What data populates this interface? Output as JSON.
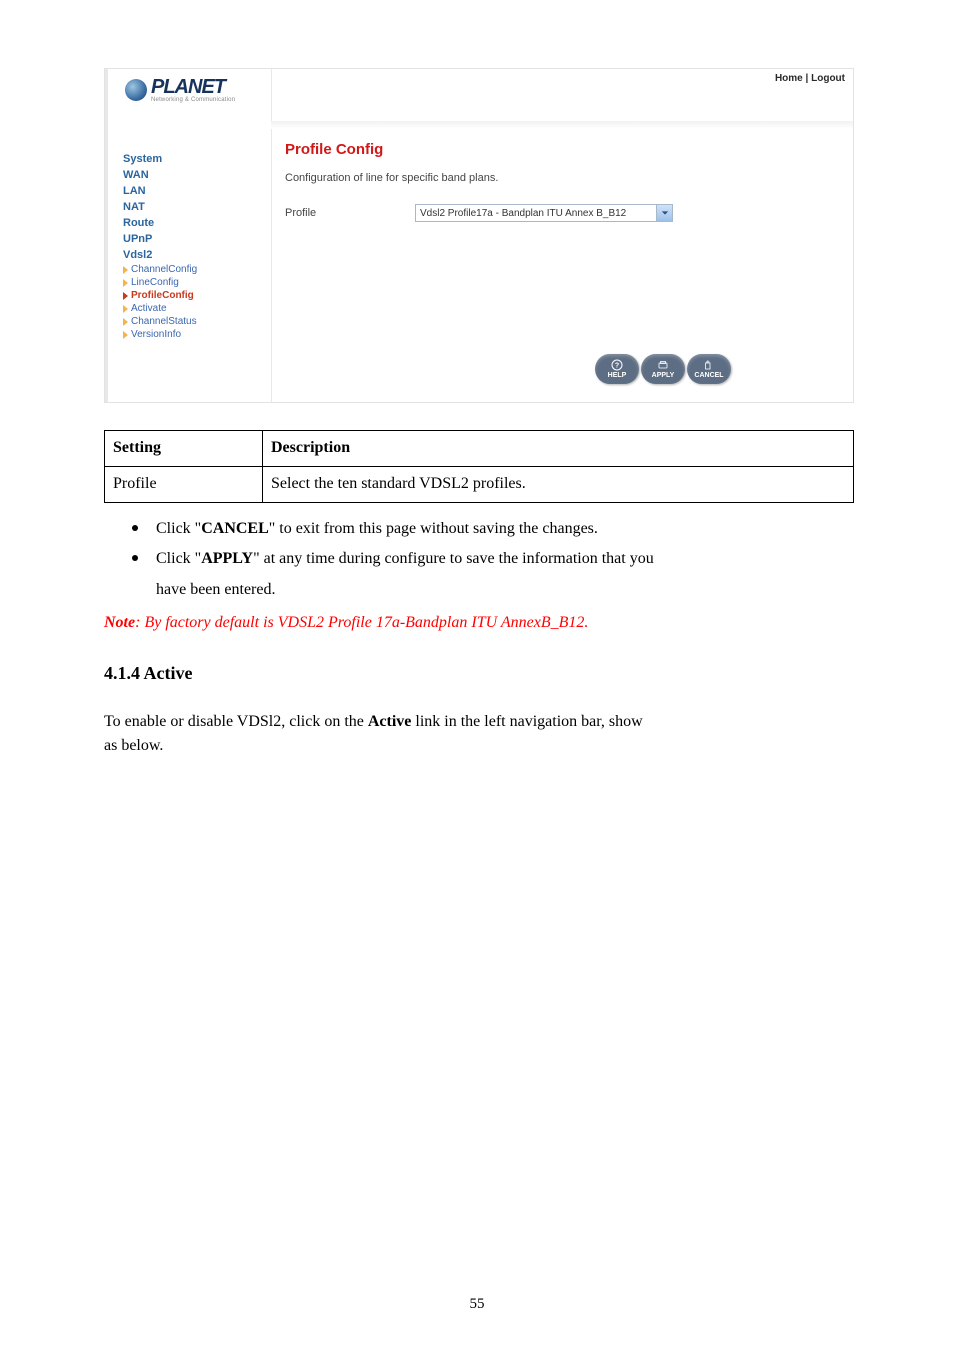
{
  "top_links": {
    "home": "Home",
    "sep": "|",
    "logout": "Logout"
  },
  "logo": {
    "brand": "PLANET",
    "tagline": "Networking & Communication"
  },
  "sidebar": {
    "items": [
      "System",
      "WAN",
      "LAN",
      "NAT",
      "Route",
      "UPnP",
      "Vdsl2"
    ],
    "subs": [
      "ChannelConfig",
      "LineConfig",
      "ProfileConfig",
      "Activate",
      "ChannelStatus",
      "VersionInfo"
    ],
    "active_sub_index": 2
  },
  "panel": {
    "title": "Profile Config",
    "subtitle": "Configuration of line for specific band plans.",
    "field_label": "Profile",
    "select_value": "Vdsl2 Profile17a - Bandplan ITU Annex B_B12"
  },
  "buttons": {
    "help": "HELP",
    "apply": "APPLY",
    "cancel": "CANCEL"
  },
  "table": {
    "head_setting": "Setting",
    "head_desc": "Description",
    "row_setting": "Profile",
    "row_desc": "Select the ten standard VDSL2 profiles."
  },
  "bullets": {
    "b1_pre": "Click \"",
    "b1_bold": "CANCEL",
    "b1_post": "\" to exit from this page without saving the changes.",
    "b2_pre": "Click \"",
    "b2_bold": "APPLY",
    "b2_post": "\" at any time during configure to save the information that you",
    "b2_cont": "have been entered."
  },
  "note": {
    "label": "Note",
    "text": ": By factory default is VDSL2 Profile 17a-Bandplan ITU AnnexB_B12."
  },
  "section": {
    "heading": "4.1.4  Active",
    "p1a": "To enable or disable VDSl2, click on the ",
    "p1b": "Active",
    "p1c": " link in the left navigation bar, show",
    "p2": "as below."
  },
  "page_number": "55"
}
